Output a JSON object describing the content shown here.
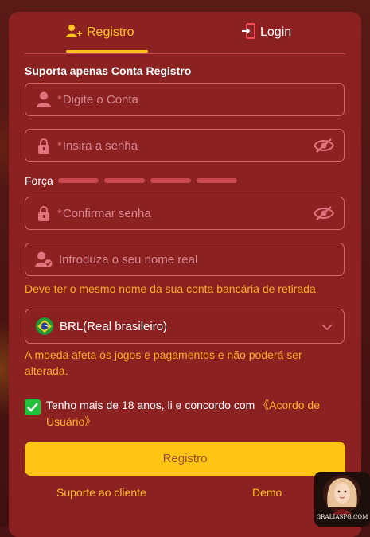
{
  "tabs": [
    {
      "label": "Registro",
      "icon": "user-plus-icon",
      "active": true
    },
    {
      "label": "Login",
      "icon": "login-door-icon",
      "active": false
    }
  ],
  "form": {
    "subtitle": "Suporta apenas Conta Registro",
    "required_mark": "*",
    "account": {
      "placeholder": "Digite o Conta",
      "icon": "user-icon"
    },
    "password": {
      "placeholder": "Insira a senha",
      "icon": "lock-icon"
    },
    "strength_label": "Força",
    "confirm": {
      "placeholder": "Confirmar senha",
      "icon": "lock-icon"
    },
    "realname": {
      "placeholder": "Introduza o seu nome real",
      "icon": "user-check-icon"
    },
    "realname_hint": "Deve ter o mesmo nome da sua conta bancária de retirada",
    "currency": {
      "value": "BRL(Real brasileiro)",
      "icon": "brazil-flag-icon"
    },
    "currency_hint": "A moeda afeta os jogos e pagamentos e não poderá ser alterada.",
    "agree_text": "Tenho mais de 18 anos, li e concordo com ",
    "agree_link": "《Acordo de Usuário》",
    "agree_checked": true,
    "submit_label": "Registro"
  },
  "footer": {
    "support": "Suporte ao cliente",
    "demo": "Demo"
  },
  "floating_badge": {
    "caption": "GRALIASPG.COM"
  },
  "colors": {
    "accent": "#ffc21f",
    "panel": "#8b2121",
    "border": "#d76670",
    "hint": "#ffab26",
    "check": "#1fc23a"
  }
}
